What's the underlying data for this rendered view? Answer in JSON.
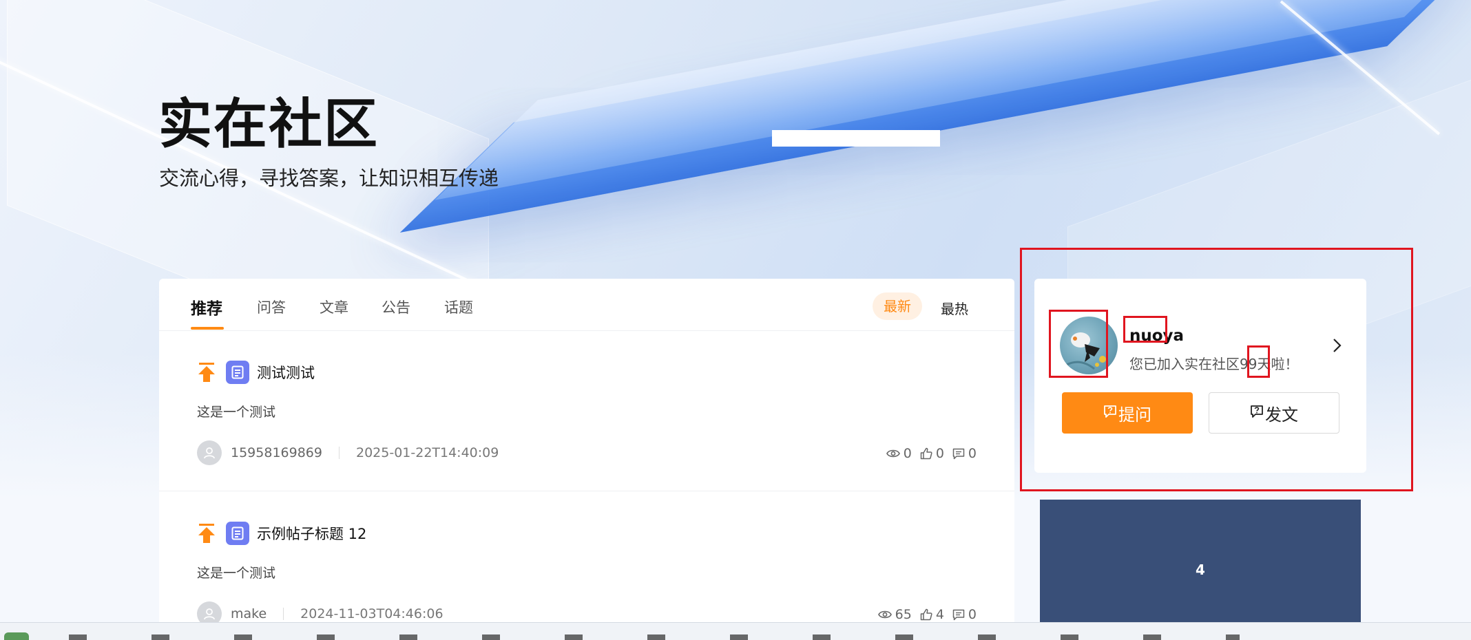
{
  "hero": {
    "title": "实在社区",
    "subtitle": "交流心得，寻找答案，让知识相互传递"
  },
  "tabs": [
    {
      "label": "推荐",
      "active": true
    },
    {
      "label": "问答",
      "active": false
    },
    {
      "label": "文章",
      "active": false
    },
    {
      "label": "公告",
      "active": false
    },
    {
      "label": "话题",
      "active": false
    }
  ],
  "sort": {
    "latest": "最新",
    "hot": "最热",
    "selected": "最新"
  },
  "posts": [
    {
      "title": "测试测试",
      "excerpt": "这是一个测试",
      "author": "15958169869",
      "date": "2025-01-22T14:40:09",
      "views": "0",
      "likes": "0",
      "comments": "0"
    },
    {
      "title": "示例帖子标题 12",
      "excerpt": "这是一个测试",
      "author": "make",
      "date": "2024-11-03T04:46:06",
      "views": "65",
      "likes": "4",
      "comments": "0"
    }
  ],
  "user": {
    "name": "nuoya",
    "joined_text": "您已加入实在社区99天啦！",
    "ask_label": "提问",
    "post_label": "发文"
  },
  "banner": {
    "text": "4"
  },
  "colors": {
    "accent": "#ff8a14",
    "accent_light": "#fff0e2",
    "type_badge": "#6f7df2",
    "banner_bg": "#394f78",
    "annotation": "#e0151f"
  },
  "icons": {
    "pin": "arrow-up-to-top-icon",
    "type": "document-icon",
    "views": "eye-icon",
    "likes": "thumbs-up-icon",
    "comments": "comment-icon",
    "arrow": "chevron-right-icon"
  }
}
